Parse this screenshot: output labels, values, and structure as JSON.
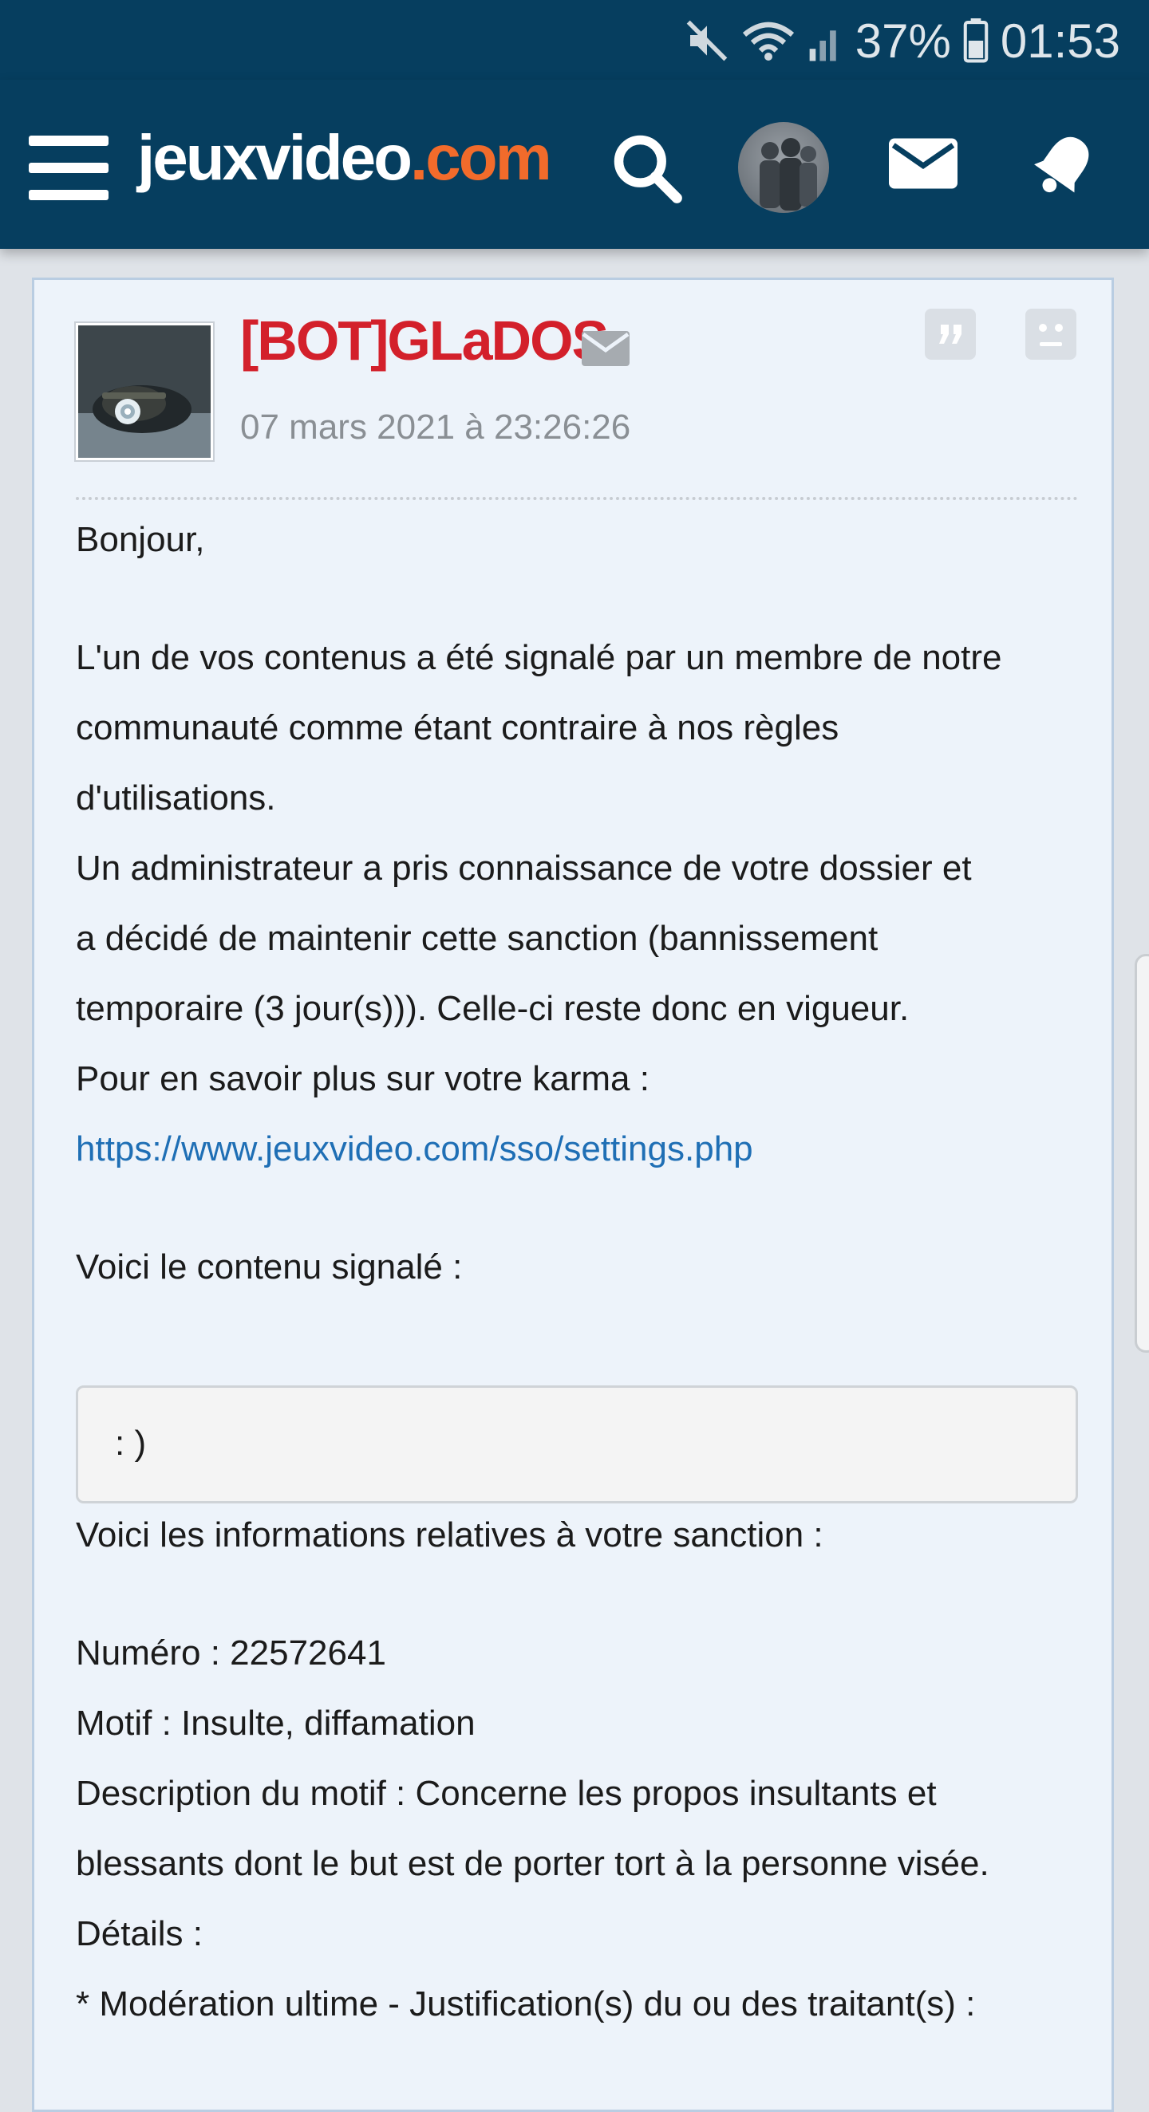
{
  "status_bar": {
    "battery": "37%",
    "time": "01:53",
    "icons": [
      "mute-icon",
      "wifi-icon",
      "signal-icon",
      "battery-icon"
    ]
  },
  "header": {
    "logo_main": "jeuxvideo",
    "logo_ext": ".com",
    "logo_colors": {
      "main": "#ffffff",
      "ext": "#f26b2b"
    },
    "background": "#063e5f",
    "icons": [
      "menu-icon",
      "search-icon",
      "avatar",
      "mail-icon",
      "bell-icon"
    ]
  },
  "post": {
    "author": "[BOT]GLaDOS",
    "author_color": "#d3202b",
    "date": "07 mars 2021 à 23:26:26",
    "lines": {
      "greeting": "Bonjour,",
      "p1_l1": "L'un de vos contenus a été signalé par un membre de notre",
      "p1_l2": "communauté comme étant contraire à nos règles",
      "p1_l3": "d'utilisations.",
      "p2_l1": "Un administrateur a pris connaissance de votre dossier et",
      "p2_l2": "a décidé de maintenir cette sanction (bannissement",
      "p2_l3": "temporaire (3 jour(s))). Celle-ci reste donc en vigueur.",
      "karma": "Pour en savoir plus sur votre karma :",
      "link": "https://www.jeuxvideo.com/sso/settings.php",
      "content_intro": "Voici le contenu signalé :",
      "quoted_content": ": )",
      "info_intro": "Voici les informations relatives à votre sanction :",
      "numero": "Numéro : 22572641",
      "motif": "Motif : Insulte, diffamation",
      "desc_l1": "Description du motif : Concerne les propos insultants et",
      "desc_l2": "blessants dont le but est de porter tort à la personne visée.",
      "details": "Détails :",
      "moderation": "* Modération ultime - Justification(s) du ou des traitant(s) :"
    }
  }
}
